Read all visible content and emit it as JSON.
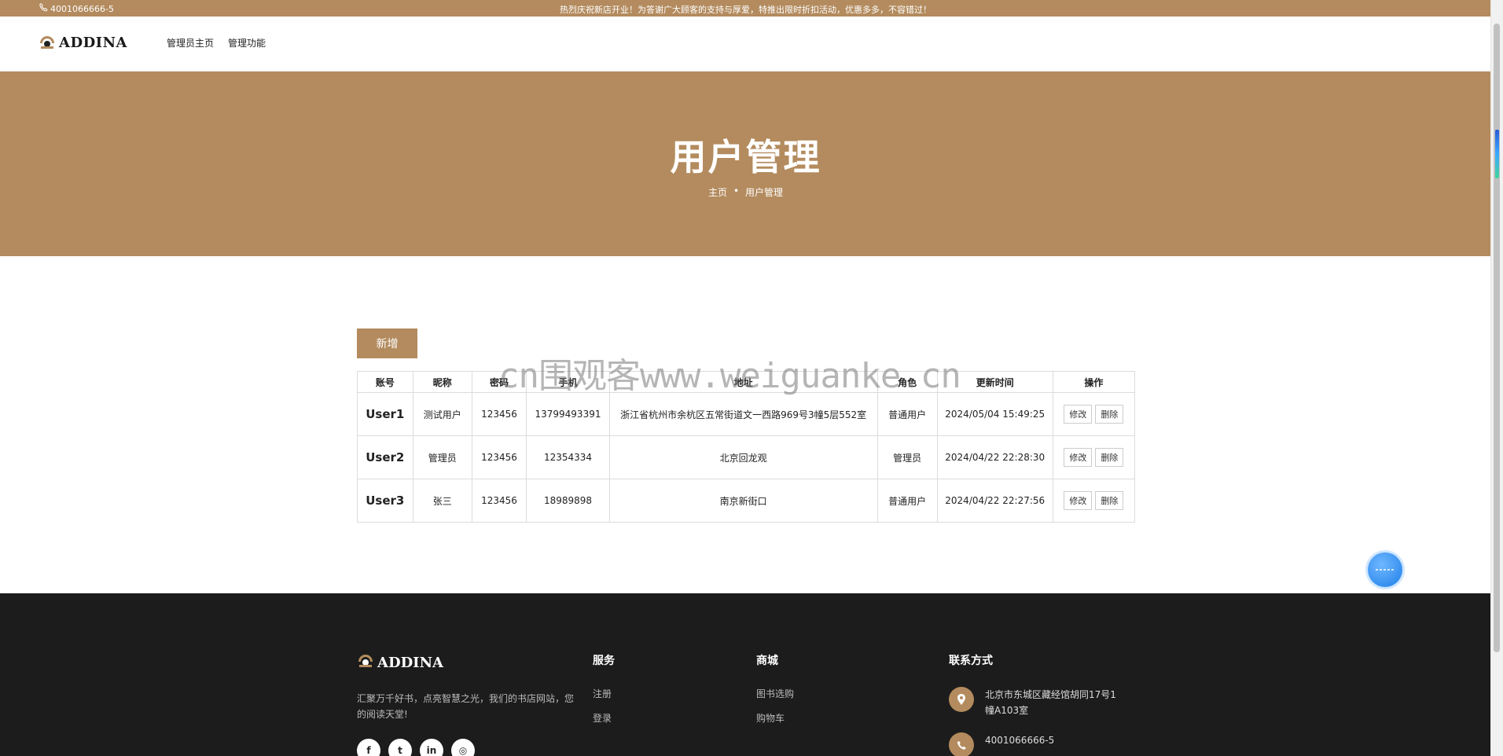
{
  "topbar": {
    "phone": "4001066666-5",
    "notice": "热烈庆祝新店开业！为答谢广大顾客的支持与厚爱，特推出限时折扣活动，优惠多多，不容错过！"
  },
  "header": {
    "logo_text": "ADDINA",
    "nav": [
      "管理员主页",
      "管理功能"
    ]
  },
  "hero": {
    "title": "用户管理",
    "breadcrumb": [
      "主页",
      "用户管理"
    ],
    "separator": "•"
  },
  "toolbar": {
    "add_label": "新增"
  },
  "table": {
    "columns": [
      "账号",
      "昵称",
      "密码",
      "手机",
      "地址",
      "角色",
      "更新时间",
      "操作"
    ],
    "rows": [
      {
        "account": "User1",
        "nickname": "测试用户",
        "password": "123456",
        "phone": "13799493391",
        "address": "浙江省杭州市余杭区五常街道文一西路969号3幢5层552室",
        "role": "普通用户",
        "updated": "2024/05/04 15:49:25",
        "edit": "修改",
        "delete": "删除"
      },
      {
        "account": "User2",
        "nickname": "管理员",
        "password": "123456",
        "phone": "12354334",
        "address": "北京回龙观",
        "role": "管理员",
        "updated": "2024/04/22 22:28:30",
        "edit": "修改",
        "delete": "删除"
      },
      {
        "account": "User3",
        "nickname": "张三",
        "password": "123456",
        "phone": "18989898",
        "address": "南京新街口",
        "role": "普通用户",
        "updated": "2024/04/22 22:27:56",
        "edit": "修改",
        "delete": "删除"
      }
    ]
  },
  "watermark": "cn围观客www.weiguanke.cn",
  "footer": {
    "logo_text": "ADDINA",
    "description": "汇聚万千好书，点亮智慧之光，我们的书店网站，您的阅读天堂!",
    "social": [
      "f",
      "t",
      "in",
      "◎"
    ],
    "services": {
      "title": "服务",
      "links": [
        "注册",
        "登录"
      ]
    },
    "mall": {
      "title": "商城",
      "links": [
        "图书选购",
        "购物车"
      ]
    },
    "contact": {
      "title": "联系方式",
      "address": "北京市东城区藏经馆胡同17号1幢A103室",
      "phone": "4001066666-5"
    }
  },
  "colors": {
    "brand": "#b38b5e",
    "footer_bg": "#1c1c1c"
  },
  "icons": [
    "phone-icon",
    "logo-icon",
    "location-icon",
    "phone-circle-icon",
    "facebook-icon",
    "twitter-icon",
    "linkedin-icon",
    "instagram-icon",
    "float-action-icon"
  ]
}
